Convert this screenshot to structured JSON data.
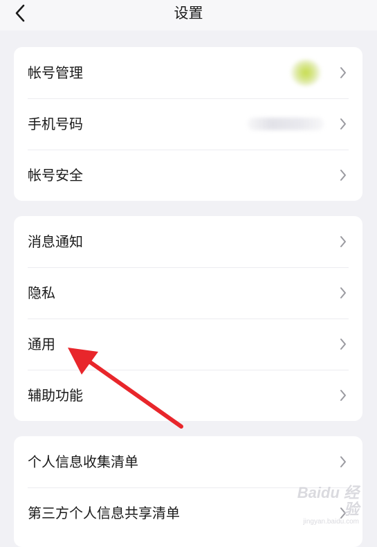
{
  "header": {
    "title": "设置",
    "back_icon": "chevron-left-icon"
  },
  "groups": [
    {
      "items": [
        {
          "label": "帐号管理",
          "accessory": "avatar (blurred)"
        },
        {
          "label": "手机号码",
          "accessory": "phone number (blurred)"
        },
        {
          "label": "帐号安全"
        }
      ]
    },
    {
      "items": [
        {
          "label": "消息通知"
        },
        {
          "label": "隐私"
        },
        {
          "label": "通用"
        },
        {
          "label": "辅助功能"
        }
      ]
    },
    {
      "items": [
        {
          "label": "个人信息收集清单"
        },
        {
          "label": "第三方个人信息共享清单"
        }
      ]
    }
  ],
  "annotation": {
    "type": "arrow",
    "points_to": "通用",
    "color": "#e8262b"
  },
  "watermark": {
    "logo": "Baidu 经验",
    "url": "jingyan.baidu.com"
  },
  "colors": {
    "page_background": "#f1f1f5",
    "card_background": "#ffffff",
    "chevron": "#9a9aa0",
    "annotation_arrow": "#e8262b"
  }
}
